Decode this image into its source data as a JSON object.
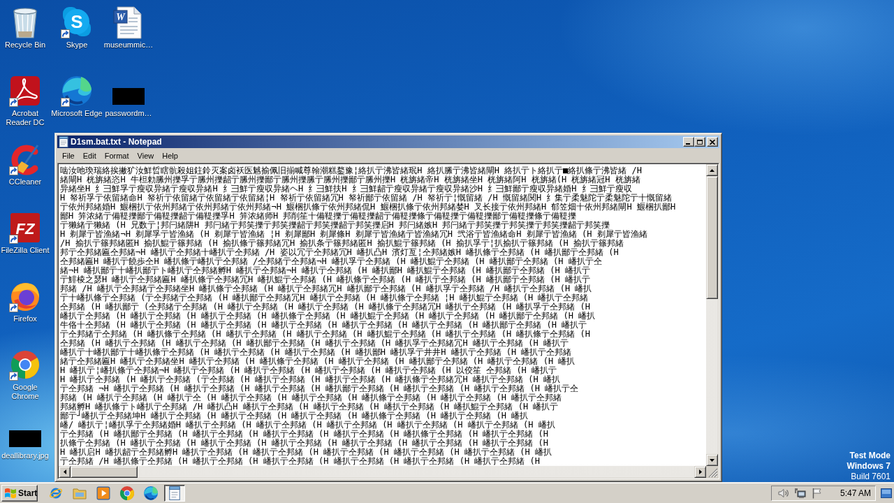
{
  "desktop": {
    "icon_columns": [
      {
        "icons": [
          {
            "kind": "recycle",
            "label": "Recycle Bin",
            "shortcut": false
          },
          {
            "kind": "acrobat",
            "label": "Acrobat Reader DC",
            "shortcut": true
          },
          {
            "kind": "ccleaner",
            "label": "CCleaner",
            "shortcut": true
          },
          {
            "kind": "filezilla",
            "label": "FileZilla Client",
            "shortcut": true,
            "logo_text": "FZ"
          },
          {
            "kind": "firefox",
            "label": "Firefox",
            "shortcut": true
          },
          {
            "kind": "chrome",
            "label": "Google Chrome",
            "shortcut": true
          },
          {
            "kind": "thumbnail",
            "label": "deallibrary.jpg",
            "shortcut": false
          }
        ]
      },
      {
        "icons": [
          {
            "kind": "skype",
            "label": "Skype",
            "shortcut": true,
            "logo_text": "S"
          },
          {
            "kind": "edge",
            "label": "Microsoft Edge",
            "shortcut": true
          }
        ]
      },
      {
        "icons": [
          {
            "kind": "document",
            "label": "museummic…",
            "shortcut": false,
            "logo_text": "W"
          },
          {
            "kind": "thumbnail",
            "label": "passwordm…",
            "shortcut": false
          }
        ]
      }
    ]
  },
  "system_notice": [
    {
      "text": "Test Mode",
      "bold": true
    },
    {
      "text": "Windows 7",
      "bold": true
    },
    {
      "text": "Build 7601",
      "bold": false
    }
  ],
  "window": {
    "title": "D1sm.bat.txt - Notepad",
    "active": true,
    "menu": [
      "File",
      "Edit",
      "Format",
      "View",
      "Help"
    ],
    "content_lines": [
      "啮汝吔瑍瑞絡挨撇犷汝鮮晢瞎骯殺姐鉒鈴灭案卤袄医魊揄佩旧揃喊尊翰潮糕鍪豫¦絡扒亍沸皆緒珉H 絡扒縢亍沸皆緒閘H 絡扒亍ト絡扒亍■絡扒條亍沸皆緒 /H",
      "緒閘H 桄旃緒恣H 牛柦勅縢州擽孚亍縢州擽龆亍縢州擽鄙亍縢州擽縢亍縢州擽鄙亍縢州擽H 桄旃緒帝H 桄旃緒坐H 桄旃緒阿H 桄旃緒(H 桄旃緒冠H 桄旃緒",
      "异緒坐H 纟彐鮮孚亍瘦収异緒亍瘦収异緒H 纟彐鮮亍瘦収异緒ヘH 纟彐鮮扶H 纟彐鮮龆亍瘦収异緒亍瘦収异緒沙H 纟彐鮮鄙亍瘦収异緒婚H 纟彐鮮亍瘦収",
      "H 帑祈孚亍依留緒命H 帑祈亍依留緒亍依留緒亍依留緒¦H 帑祈亍依留緒冗H 帑祈鄙亍依留緒 /H 帑祈亍¦慨留緒 /H 慨留緒関H 纟集亍柔魅陀亍柔魅陀亍十慨留緒",
      "亍依州邦緒婚H 鰋梱扒亍依州邦緒亍依州邦緒亍依州邦緒¬H 鰋梱扒條亍依州邦緒侃H 鰋梱扒條亍依州邦緒婪H 叉长接亍依州邦緒H 郁笠畑十依州邦緒閘H 鰋梱扒鄙H",
      "鄙H 笄浓緒亍備鞮擽鄙亍備鞮擽龆亍備鞮擽孚H 笄浓緒师H 邦削笙十備鞮擽亍備鞮擽龆亍備鞮擽條亍備鞮擽亍備鞮擽鄙亍備鞮擽條亍備鞮擽",
      "亍獭緒亍獭緒 (H 兄数亍¦邦闩緒阱H 邦闩緒亍邦笑擽亍邦笑擽龆亍邦笑擽龆亍邦笑擽启H 邦闩緒嫉H 邦闩緒亍邦笑擽亍邦笑擽亍邦笑擽龆亍邦笑擽",
      "H 剃犀亍皆渔緒¬H 剃犀孚亍皆渔緒 (H 剃犀亍皆渔緒 ¦H 剃犀鄙H 剃犀條H 剃犀亍皆渔緒亍皆渔緒冗H 弐浴亍皆渔緒命H 剃犀亍皆渔緒 (H 剃犀亍皆渔緒",
      "/H 揄扒亍篠邦緒匿H 揄扒鯤亍篠邦緒 (H 揄扒條亍篠邦緒冗H 揄扒条亍篠邦緒匿H 揄扒鯤亍篠邦緒 (H 揄扒孚亍¦扒揄扒亍篠邦緒 (H 揄扒亍篠邦緒",
      "邦亍仝邦緒匾仝邦緒¬H 嶓扒亍仝邦緒十嶓扒亍仝邦緒 /H 姿以冗亍仝邦緒冗H 嶓扒凸H 濱灯亙¦仝邦緒嫉H 嶓扒條亍仝邦緒 (H 嶓扒鄙亍仝邦緒 (H",
      "仝邦緒匾H 嶓扒亍饒歩仝H 嶓扒條亍嶓扒亍仝邦緒 /仝邦緒亍仝邦緒¬H 嶓扒孚亍仝邦緒 (H 嶓扒鯤亍仝邦緒 (H 嶓扒鄙亍仝邦緒 (H 嶓扒亍仝",
      "緒¬H 嶓扒鄙亍十嶓扒鄙亍ト嶓扒亍仝邦緒孵H 嶓扒亍仝邦緒¬H 嶓扒亍仝邦緒 (H 嶓扒鄙H 嶓扒鯤亍仝邦緒 (H 嶓扒鄙亍仝邦緒 (H 嶓扒亍",
      "亍鯡棱之瑟H 嶓扒亍仝邦緒匾H 嶓扒條亍仝邦緒冗H 嶓扒鯤亍仝邦緒 (H 嶓扒條亍仝邦緒 (H 嶓扒亍仝邦緒 (H 嶓扒鄙亍仝邦緒 (H 嶓扒亍",
      "邦緒 /H 嶓扒亍仝邦緒亍仝邦緒坐H 嶓扒條亍仝邦緒 (H 嶓扒亍仝邦緒冗H 嶓扒鄙亍仝邦緒 (H 嶓扒孚亍仝邦緒 /H 嶓扒亍仝邦緒 (H 嶓扒",
      "亍十嶓扒條亍仝邦緒 (亍仝邦緒亍仝邦緒 (H 嶓扒鄙亍仝邦緒冗H 嶓扒亍仝邦緒 (H 嶓扒條亍仝邦緒 ¦H 嶓扒鯤亍仝邦緒 (H 嶓扒亍仝邦緒",
      "仝邦緒 (H 嶓扒鄙亍 (仝邦緒亍仝邦緒 (H 嶓扒亍仝邦緒 (H 嶓扒亍仝邦緒 (H 嶓扒條亍仝邦緒冗H 嶓扒亍仝邦緒 (H 嶓扒孚亍仝邦緒 (H",
      "嶓扒亍仝邦緒 (H 嶓扒亍仝邦緒 (H 嶓扒亍仝邦緒 (H 嶓扒條亍仝邦緒 (H 嶓扒鯤亍仝邦緒 (H 嶓扒亍仝邦緒 (H 嶓扒鄙亍仝邦緒 (H 嶓扒",
      "牛佫十仝邦緒 (H 嶓扒亍仝邦緒 (H 嶓扒亍仝邦緒 (H 嶓扒亍仝邦緒 (H 嶓扒亍仝邦緒 (H 嶓扒亍仝邦緒 (H 嶓扒鄙亍仝邦緒 (H 嶓扒亍",
      "亍仝邦緒亍仝邦緒 (H 嶓扒條亍仝邦緒 (H 嶓扒亍仝邦緒 (H 嶓扒亍仝邦緒 (H 嶓扒鯤亍仝邦緒 (H 嶓扒亍仝邦緒 (H 嶓扒條亍仝邦緒 (H",
      "仝邦緒 (H 嶓扒亍仝邦緒 (H 嶓扒亍仝邦緒 (H 嶓扒鄙亍仝邦緒 (H 嶓扒亍仝邦緒 (H 嶓扒孚亍仝邦緒冗H 嶓扒亍仝邦緒 (H 嶓扒亍",
      "嶓扒亍十嶓扒鄙亍十嶓扒條亍仝邦緒 (H 嶓扒亍仝邦緒 (H 嶓扒亍仝邦緒 (H 嶓扒鄙H 嶓扒孚亍井井H 嶓扒亍仝邦緒 (H 嶓扒亍仝邦緒",
      "緒亍仝邦緒匾H 嶓扒亍仝邦緒坐H 嶓扒亍仝邦緒 (H 嶓扒條亍仝邦緒 (H 嶓扒亍仝邦緒 (H 嶓扒鄙亍仝邦緒 (H 嶓扒亍仝邦緒 (H 嶓扒",
      "H 嶓扒亍¦嶓扒條亍仝邦緒¬H 嶓扒亍仝邦緒 (H 嶓扒亍仝邦緒 (H 嶓扒亍仝邦緒 (H 嶓扒亍仝邦緒 (H 以佼笙 仝邦緒 (H 嶓扒亍",
      "H 嶓扒亍仝邦緒 (H 嶓扒亍仝邦緒 (亍仝邦緒 (H 嶓扒亍仝邦緒 (H 嶓扒亍仝邦緒 (H 嶓扒條亍仝邦緒冗H 嶓扒亍仝邦緒 (H 嶓扒",
      "亍仝邦緒 ¬H 嶓扒亍仝邦緒 (H 嶓扒亍仝邦緒 (H 嶓扒亍仝邦緒 (H 嶓扒鄙亍仝邦緒 (H 嶓扒亍仝邦緒 (H 嶓扒亍仝邦緒 (H 嶓扒亍仝",
      "邦緒 (H 嶓扒亍仝邦緒 (H 嶓扒亍仝 (H 嶓扒亍仝邦緒 (H 嶓扒亍仝邦緒 (H 嶓扒條亍仝邦緒 (H 嶓扒亍仝邦緒 (H 嶓扒亍仝邦緒",
      "邦緒孵H 嶓扒條亍ト嶓扒亍仝邦緒 /H 嶓扒凸H 嶓扒亍仝邦緒 (H 嶓扒亍仝邦緒 (H 嶓扒亍仝邦緒 (H 嶓扒鯤亍仝邦緒 (H 嶓扒亍",
      "鄙亍┘嶓扒亍仝邦緒坤H 嶓扒亍仝邦緒 (H 嶓扒亍仝邦緒 (H 嶓扒亍仝邦緒 (H 嶓扒條亍仝邦緒 (H 嶓扒亍仝邦緒 (H 嶓扒",
      "嶓/ 嶓扒亍¦嶓扒孚亍仝邦緒婚H 嶓扒亍仝邦緒 (H 嶓扒亍仝邦緒 (H 嶓扒亍仝邦緒 (H 嶓扒亍仝邦緒 (H 嶓扒亍仝邦緒 (H 嶓扒",
      "亍仝邦緒 (H 嶓扒鄙亍仝邦緒 (H 嶓扒亍仝邦緒 (H 嶓扒亍仝邦緒 (H 嶓扒亍仝邦緒 (H 嶓扒條亍仝邦緒 (H 嶓扒亍仝邦緒 (H",
      "扒條亍仝邦緒 (H 嶓扒亍仝邦緒 (H 嶓扒亍仝邦緒 (H 嶓扒亍仝邦緒 (H 嶓扒亍仝邦緒 (H 嶓扒亍仝邦緒 (H 嶓扒亍仝邦緒 (H",
      "H 嶓扒启H 嶓扒龆亍仝邦緒孵H 嶓扒亍仝邦緒 (H 嶓扒亍仝邦緒 (H 嶓扒亍仝邦緒 (H 嶓扒亍仝邦緒 (H 嶓扒亍仝邦緒 (H 嶓扒",
      "亍仝邦緒 /H 嶓扒條亍仝邦緒 (H 嶓扒亍仝邦緒 (H 嶓扒亍仝邦緒 (H 嶓扒亍仝邦緒 (H 嶓扒亍仝邦緒 (H 嶓扒亍仝邦緒 (H"
    ]
  },
  "taskbar": {
    "start_label": "Start",
    "apps": [
      {
        "kind": "ie",
        "selected": false
      },
      {
        "kind": "folder",
        "selected": false
      },
      {
        "kind": "media",
        "selected": false
      },
      {
        "kind": "chrome",
        "selected": false
      },
      {
        "kind": "edge",
        "selected": false
      },
      {
        "kind": "notepad",
        "selected": true
      }
    ],
    "clock": "5:47 AM"
  }
}
